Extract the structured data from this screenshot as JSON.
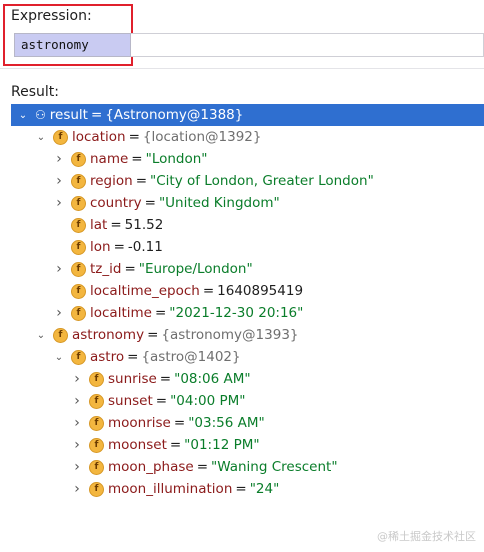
{
  "expression": {
    "label": "Expression:",
    "value": "astronomy"
  },
  "result": {
    "label": "Result:",
    "tree": [
      {
        "depth": 0,
        "arrow": "down",
        "icon": "glasses-icon",
        "name": "result",
        "eq": "=",
        "value": "{Astronomy@1388}",
        "kind": "obj",
        "selected": true
      },
      {
        "depth": 1,
        "arrow": "down",
        "icon": "field-icon",
        "name": "location",
        "eq": "=",
        "value": "{location@1392}",
        "kind": "ref"
      },
      {
        "depth": 2,
        "arrow": "right",
        "icon": "field-icon",
        "name": "name",
        "eq": "=",
        "value": "\"London\"",
        "kind": "str"
      },
      {
        "depth": 2,
        "arrow": "right",
        "icon": "field-icon",
        "name": "region",
        "eq": "=",
        "value": "\"City of London, Greater London\"",
        "kind": "str"
      },
      {
        "depth": 2,
        "arrow": "right",
        "icon": "field-icon",
        "name": "country",
        "eq": "=",
        "value": "\"United Kingdom\"",
        "kind": "str"
      },
      {
        "depth": 2,
        "arrow": "none",
        "icon": "field-icon",
        "name": "lat",
        "eq": "=",
        "value": "51.52",
        "kind": "num"
      },
      {
        "depth": 2,
        "arrow": "none",
        "icon": "field-icon",
        "name": "lon",
        "eq": "=",
        "value": "-0.11",
        "kind": "num"
      },
      {
        "depth": 2,
        "arrow": "right",
        "icon": "field-icon",
        "name": "tz_id",
        "eq": "=",
        "value": "\"Europe/London\"",
        "kind": "str"
      },
      {
        "depth": 2,
        "arrow": "none",
        "icon": "field-icon",
        "name": "localtime_epoch",
        "eq": "=",
        "value": "1640895419",
        "kind": "num"
      },
      {
        "depth": 2,
        "arrow": "right",
        "icon": "field-icon",
        "name": "localtime",
        "eq": "=",
        "value": "\"2021-12-30 20:16\"",
        "kind": "str"
      },
      {
        "depth": 1,
        "arrow": "down",
        "icon": "field-icon",
        "name": "astronomy",
        "eq": "=",
        "value": "{astronomy@1393}",
        "kind": "ref"
      },
      {
        "depth": 2,
        "arrow": "down",
        "icon": "field-icon",
        "name": "astro",
        "eq": "=",
        "value": "{astro@1402}",
        "kind": "ref"
      },
      {
        "depth": 3,
        "arrow": "right",
        "icon": "field-icon",
        "name": "sunrise",
        "eq": "=",
        "value": "\"08:06 AM\"",
        "kind": "str"
      },
      {
        "depth": 3,
        "arrow": "right",
        "icon": "field-icon",
        "name": "sunset",
        "eq": "=",
        "value": "\"04:00 PM\"",
        "kind": "str"
      },
      {
        "depth": 3,
        "arrow": "right",
        "icon": "field-icon",
        "name": "moonrise",
        "eq": "=",
        "value": "\"03:56 AM\"",
        "kind": "str"
      },
      {
        "depth": 3,
        "arrow": "right",
        "icon": "field-icon",
        "name": "moonset",
        "eq": "=",
        "value": "\"01:12 PM\"",
        "kind": "str"
      },
      {
        "depth": 3,
        "arrow": "right",
        "icon": "field-icon",
        "name": "moon_phase",
        "eq": "=",
        "value": "\"Waning Crescent\"",
        "kind": "str"
      },
      {
        "depth": 3,
        "arrow": "right",
        "icon": "field-icon",
        "name": "moon_illumination",
        "eq": "=",
        "value": "\"24\"",
        "kind": "str"
      }
    ]
  },
  "watermark": "@稀土掘金技术社区",
  "colors": {
    "selection": "#2f6fd0",
    "string": "#0a7d2a",
    "field_name": "#8b1a1a",
    "highlight_border": "#e0202c"
  }
}
